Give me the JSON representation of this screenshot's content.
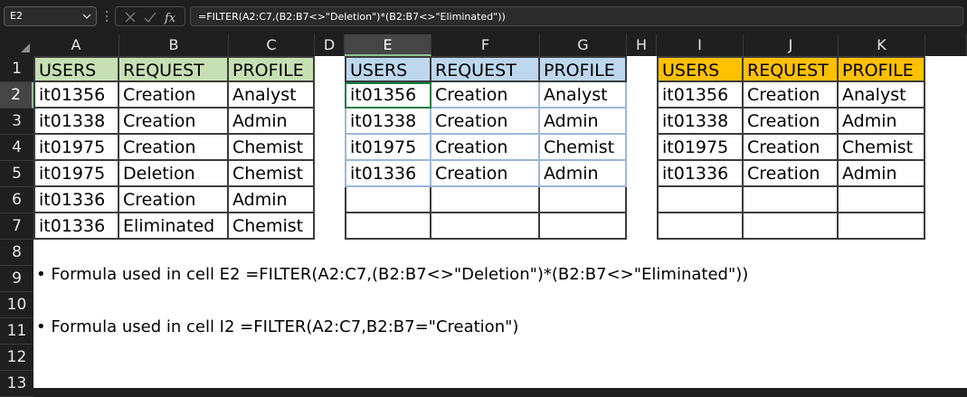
{
  "formula_bar": {
    "name_box": "E2",
    "formula": "=FILTER(A2:C7,(B2:B7<>\"Deletion\")*(B2:B7<>\"Eliminated\"))",
    "icons": [
      "cancel-icon",
      "enter-icon",
      "insert-function-icon"
    ]
  },
  "columns": [
    "A",
    "B",
    "C",
    "D",
    "E",
    "F",
    "G",
    "H",
    "I",
    "J",
    "K"
  ],
  "selected_column": "E",
  "selected_row": "2",
  "rows": [
    "1",
    "2",
    "3",
    "4",
    "5",
    "6",
    "7",
    "8",
    "9",
    "10",
    "11",
    "12",
    "13"
  ],
  "source_table": {
    "headers": [
      "USERS",
      "REQUEST",
      "PROFILE"
    ],
    "header_color": "#c6e0b4",
    "rows": [
      [
        "it01356",
        "Creation",
        "Analyst"
      ],
      [
        "it01338",
        "Creation",
        "Admin"
      ],
      [
        "it01975",
        "Creation",
        "Chemist"
      ],
      [
        "it01975",
        "Deletion",
        "Chemist"
      ],
      [
        "it01336",
        "Creation",
        "Admin"
      ],
      [
        "it01336",
        "Eliminated",
        "Chemist"
      ]
    ]
  },
  "filter1_table": {
    "headers": [
      "USERS",
      "REQUEST",
      "PROFILE"
    ],
    "header_color": "#bdd7ee",
    "rows": [
      [
        "it01356",
        "Creation",
        "Analyst"
      ],
      [
        "it01338",
        "Creation",
        "Admin"
      ],
      [
        "it01975",
        "Creation",
        "Chemist"
      ],
      [
        "it01336",
        "Creation",
        "Admin"
      ],
      [
        "",
        "",
        ""
      ],
      [
        "",
        "",
        ""
      ]
    ]
  },
  "filter2_table": {
    "headers": [
      "USERS",
      "REQUEST",
      "PROFILE"
    ],
    "header_color": "#ffc000",
    "rows": [
      [
        "it01356",
        "Creation",
        "Analyst"
      ],
      [
        "it01338",
        "Creation",
        "Admin"
      ],
      [
        "it01975",
        "Creation",
        "Chemist"
      ],
      [
        "it01336",
        "Creation",
        "Admin"
      ],
      [
        "",
        "",
        ""
      ],
      [
        "",
        "",
        ""
      ]
    ]
  },
  "notes": {
    "line1": "• Formula used in cell E2 =FILTER(A2:C7,(B2:B7<>\"Deletion\")*(B2:B7<>\"Eliminated\"))",
    "line2": "• Formula used in cell I2 =FILTER(A2:C7,B2:B7=\"Creation\")"
  }
}
